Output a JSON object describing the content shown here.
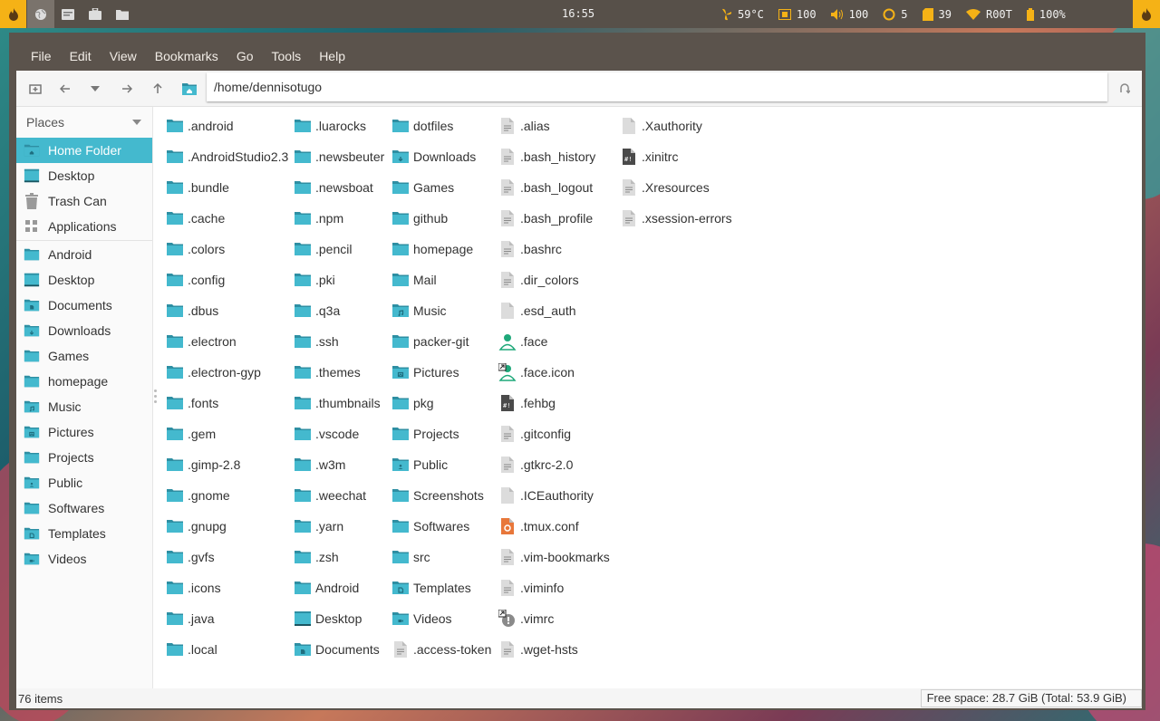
{
  "topbar": {
    "clock": "16:55",
    "status": [
      {
        "icon": "fan-icon",
        "label": "59°C"
      },
      {
        "icon": "brightness-icon",
        "label": "100"
      },
      {
        "icon": "volume-icon",
        "label": "100"
      },
      {
        "icon": "cpu-load-icon",
        "label": "5"
      },
      {
        "icon": "memory-icon",
        "label": "39"
      },
      {
        "icon": "wifi-icon",
        "label": "R00T"
      },
      {
        "icon": "battery-icon",
        "label": "100%"
      }
    ],
    "accent": "#f5b216"
  },
  "menubar": {
    "items": [
      "File",
      "Edit",
      "View",
      "Bookmarks",
      "Go",
      "Tools",
      "Help"
    ]
  },
  "toolbar": {
    "path": "/home/dennisotugo"
  },
  "sidebar": {
    "header": "Places",
    "places": [
      {
        "label": "Home Folder",
        "icon": "home-folder-icon",
        "selected": true
      },
      {
        "label": "Desktop",
        "icon": "desktop-icon"
      },
      {
        "label": "Trash Can",
        "icon": "trash-icon"
      },
      {
        "label": "Applications",
        "icon": "applications-icon"
      }
    ],
    "bookmarks": [
      {
        "label": "Android",
        "icon": "folder-icon"
      },
      {
        "label": "Desktop",
        "icon": "desktop-icon"
      },
      {
        "label": "Documents",
        "icon": "documents-folder-icon"
      },
      {
        "label": "Downloads",
        "icon": "downloads-folder-icon"
      },
      {
        "label": "Games",
        "icon": "folder-icon"
      },
      {
        "label": "homepage",
        "icon": "folder-icon"
      },
      {
        "label": "Music",
        "icon": "music-folder-icon"
      },
      {
        "label": "Pictures",
        "icon": "pictures-folder-icon"
      },
      {
        "label": "Projects",
        "icon": "folder-icon"
      },
      {
        "label": "Public",
        "icon": "public-folder-icon"
      },
      {
        "label": "Softwares",
        "icon": "folder-icon"
      },
      {
        "label": "Templates",
        "icon": "templates-folder-icon"
      },
      {
        "label": "Videos",
        "icon": "videos-folder-icon"
      }
    ]
  },
  "files": {
    "columns": [
      [
        {
          "name": ".android",
          "type": "folder"
        },
        {
          "name": ".AndroidStudio2.3",
          "type": "folder"
        },
        {
          "name": ".bundle",
          "type": "folder"
        },
        {
          "name": ".cache",
          "type": "folder"
        },
        {
          "name": ".colors",
          "type": "folder"
        },
        {
          "name": ".config",
          "type": "folder"
        },
        {
          "name": ".dbus",
          "type": "folder"
        },
        {
          "name": ".electron",
          "type": "folder"
        },
        {
          "name": ".electron-gyp",
          "type": "folder"
        },
        {
          "name": ".fonts",
          "type": "folder"
        },
        {
          "name": ".gem",
          "type": "folder"
        },
        {
          "name": ".gimp-2.8",
          "type": "folder"
        },
        {
          "name": ".gnome",
          "type": "folder"
        },
        {
          "name": ".gnupg",
          "type": "folder"
        },
        {
          "name": ".gvfs",
          "type": "folder"
        },
        {
          "name": ".icons",
          "type": "folder"
        },
        {
          "name": ".java",
          "type": "folder"
        },
        {
          "name": ".local",
          "type": "folder"
        }
      ],
      [
        {
          "name": ".luarocks",
          "type": "folder"
        },
        {
          "name": ".newsbeuter",
          "type": "folder"
        },
        {
          "name": ".newsboat",
          "type": "folder"
        },
        {
          "name": ".npm",
          "type": "folder"
        },
        {
          "name": ".pencil",
          "type": "folder"
        },
        {
          "name": ".pki",
          "type": "folder"
        },
        {
          "name": ".q3a",
          "type": "folder"
        },
        {
          "name": ".ssh",
          "type": "folder"
        },
        {
          "name": ".themes",
          "type": "folder"
        },
        {
          "name": ".thumbnails",
          "type": "folder"
        },
        {
          "name": ".vscode",
          "type": "folder"
        },
        {
          "name": ".w3m",
          "type": "folder"
        },
        {
          "name": ".weechat",
          "type": "folder"
        },
        {
          "name": ".yarn",
          "type": "folder"
        },
        {
          "name": ".zsh",
          "type": "folder"
        },
        {
          "name": "Android",
          "type": "folder"
        },
        {
          "name": "Desktop",
          "type": "desktop"
        },
        {
          "name": "Documents",
          "type": "folder-documents"
        }
      ],
      [
        {
          "name": "dotfiles",
          "type": "folder"
        },
        {
          "name": "Downloads",
          "type": "folder-downloads"
        },
        {
          "name": "Games",
          "type": "folder"
        },
        {
          "name": "github",
          "type": "folder"
        },
        {
          "name": "homepage",
          "type": "folder"
        },
        {
          "name": "Mail",
          "type": "folder"
        },
        {
          "name": "Music",
          "type": "folder-music"
        },
        {
          "name": "packer-git",
          "type": "folder"
        },
        {
          "name": "Pictures",
          "type": "folder-pictures"
        },
        {
          "name": "pkg",
          "type": "folder"
        },
        {
          "name": "Projects",
          "type": "folder"
        },
        {
          "name": "Public",
          "type": "folder-public"
        },
        {
          "name": "Screenshots",
          "type": "folder"
        },
        {
          "name": "Softwares",
          "type": "folder"
        },
        {
          "name": "src",
          "type": "folder"
        },
        {
          "name": "Templates",
          "type": "folder-templates"
        },
        {
          "name": "Videos",
          "type": "folder-videos"
        },
        {
          "name": ".access-token",
          "type": "text"
        }
      ],
      [
        {
          "name": ".alias",
          "type": "text"
        },
        {
          "name": ".bash_history",
          "type": "text"
        },
        {
          "name": ".bash_logout",
          "type": "text"
        },
        {
          "name": ".bash_profile",
          "type": "text"
        },
        {
          "name": ".bashrc",
          "type": "text"
        },
        {
          "name": ".dir_colors",
          "type": "text"
        },
        {
          "name": ".esd_auth",
          "type": "blank"
        },
        {
          "name": ".face",
          "type": "user"
        },
        {
          "name": ".face.icon",
          "type": "user-link"
        },
        {
          "name": ".fehbg",
          "type": "script"
        },
        {
          "name": ".gitconfig",
          "type": "text"
        },
        {
          "name": ".gtkrc-2.0",
          "type": "text"
        },
        {
          "name": ".ICEauthority",
          "type": "blank"
        },
        {
          "name": ".tmux.conf",
          "type": "config"
        },
        {
          "name": ".vim-bookmarks",
          "type": "text"
        },
        {
          "name": ".viminfo",
          "type": "text"
        },
        {
          "name": ".vimrc",
          "type": "warning-link"
        },
        {
          "name": ".wget-hsts",
          "type": "text"
        }
      ],
      [
        {
          "name": ".Xauthority",
          "type": "blank"
        },
        {
          "name": ".xinitrc",
          "type": "script"
        },
        {
          "name": ".Xresources",
          "type": "text"
        },
        {
          "name": ".xsession-errors",
          "type": "text"
        }
      ]
    ]
  },
  "statusbar": {
    "count": "76 items",
    "free_space": "Free space: 28.7 GiB (Total: 53.9 GiB)"
  },
  "colors": {
    "folder": "#44b9ce",
    "folder_dark": "#2e8fa3",
    "selection": "#44b9ce",
    "titlebar": "#5b534c",
    "orange": "#e8773a",
    "green": "#1fa87a"
  }
}
